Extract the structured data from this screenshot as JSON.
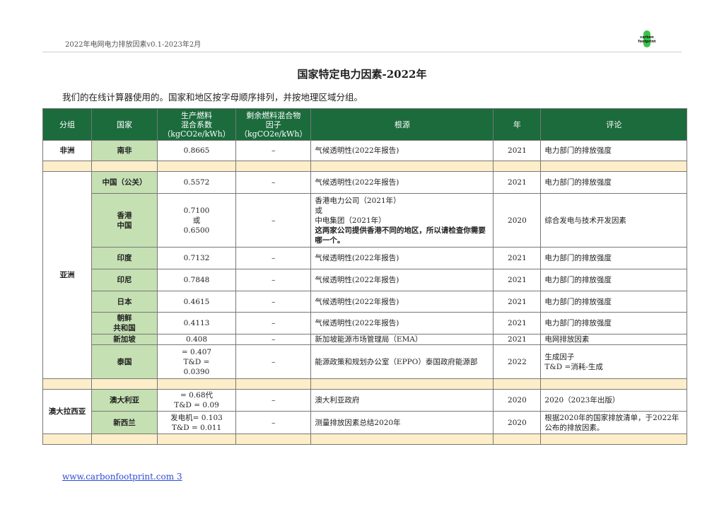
{
  "header": {
    "doc_title": "2022年电网电力排放因素v0.1-2023年2月",
    "logo_text": "carbon footprint"
  },
  "title": "国家特定电力因素-2022年",
  "subtitle": "我们的在线计算器使用的。国家和地区按字母顺序排列，并按地理区域分组。",
  "columns": [
    "分组",
    "国家",
    "生产燃料\n混合系数\n（kgCO2e/kWh）",
    "剩余燃料混合物\n因子\n（kgCO2e/kWh）",
    "根源",
    "年",
    "评论"
  ],
  "groups": {
    "africa": "非洲",
    "asia": "亚洲",
    "oceania": "澳大拉西亚"
  },
  "rows": [
    {
      "country": "南非",
      "factor": "0.8665",
      "residual": "–",
      "source": "气候透明性(2022年报告)",
      "year": "2021",
      "comment": "电力部门的排放强度"
    },
    {
      "country": "中国（公关）",
      "factor": "0.5572",
      "residual": "–",
      "source": "气候透明性(2022年报告)",
      "year": "2021",
      "comment": "电力部门的排放强度"
    },
    {
      "country": "香港\n中国",
      "factor": "0.7100\n或\n0.6500",
      "residual": "–",
      "source": "香港电力公司（2021年）\n或\n中电集团（2021年）",
      "source_note": "这两家公司提供香港不同的地区，所以请检查你需要哪一个。",
      "year": "2020",
      "comment": "综合发电与技术开发因素"
    },
    {
      "country": "印度",
      "factor": "0.7132",
      "residual": "–",
      "source": "气候透明性(2022年报告)",
      "year": "2021",
      "comment": "电力部门的排放强度"
    },
    {
      "country": "印尼",
      "factor": "0.7848",
      "residual": "–",
      "source": "气候透明性(2022年报告)",
      "year": "2021",
      "comment": "电力部门的排放强度"
    },
    {
      "country": "日本",
      "factor": "0.4615",
      "residual": "–",
      "source": "气候透明性(2022年报告)",
      "year": "2021",
      "comment": "电力部门的排放强度"
    },
    {
      "country": "朝鲜\n共和国",
      "factor": "0.4113",
      "residual": "–",
      "source": "气候透明性(2022年报告)",
      "year": "2021",
      "comment": "电力部门的排放强度"
    },
    {
      "country": "新加坡",
      "factor": "0.408",
      "residual": "–",
      "source": "新加坡能源市场管理局（EMA）",
      "year": "2021",
      "comment": "电网排放因素"
    },
    {
      "country": "泰国",
      "factor": " = 0.407\nT&D =\n0.0390",
      "residual": "–",
      "source": "能源政策和规划办公室（EPPO）泰国政府能源部",
      "year": "2022",
      "comment": "生成因子\nT&D =消耗-生成"
    },
    {
      "country": "澳大利亚",
      "factor": " = 0.68代\nT&D = 0.09",
      "residual": "–",
      "source": "澳大利亚政府",
      "year": "2020",
      "comment": "2020（2023年出版）"
    },
    {
      "country": "新西兰",
      "factor": "发电机= 0.103\nT&D = 0.011",
      "residual": "–",
      "source": "测量排放因素总结2020年",
      "year": "2020",
      "comment": "根据2020年的国家排放清单，于2022年公布的排放因素。"
    }
  ],
  "footer": {
    "website": "www.carbonfootprint.com",
    "page": "3"
  }
}
